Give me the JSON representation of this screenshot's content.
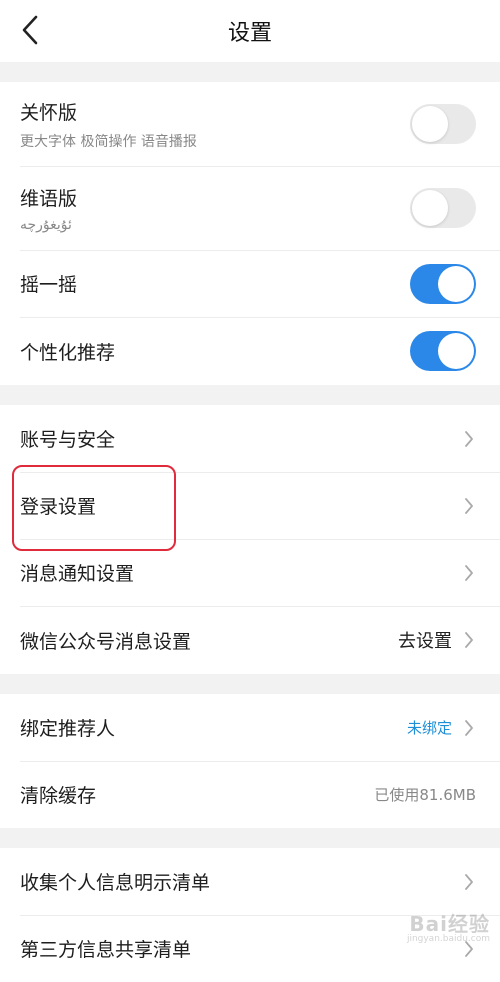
{
  "header": {
    "title": "设置"
  },
  "group1": {
    "care": {
      "label": "关怀版",
      "sub": "更大字体 极简操作 语音播报",
      "on": false
    },
    "uyghur": {
      "label": "维语版",
      "sub": "ئۇيغۇرچە",
      "on": false
    },
    "shake": {
      "label": "摇一摇",
      "on": true
    },
    "personalized": {
      "label": "个性化推荐",
      "on": true
    }
  },
  "group2": {
    "account": {
      "label": "账号与安全"
    },
    "login": {
      "label": "登录设置"
    },
    "notify": {
      "label": "消息通知设置"
    },
    "wechat": {
      "label": "微信公众号消息设置",
      "value": "去设置"
    }
  },
  "group3": {
    "referrer": {
      "label": "绑定推荐人",
      "value": "未绑定"
    },
    "cache": {
      "label": "清除缓存",
      "value": "已使用81.6MB"
    }
  },
  "group4": {
    "personal": {
      "label": "收集个人信息明示清单"
    },
    "third": {
      "label": "第三方信息共享清单"
    }
  },
  "watermark": {
    "main": "Bai经验",
    "sub": "jingyan.baidu.com"
  },
  "colors": {
    "accent": "#2b88e8",
    "link": "#1e8fd6",
    "highlight": "#e02b3c"
  }
}
